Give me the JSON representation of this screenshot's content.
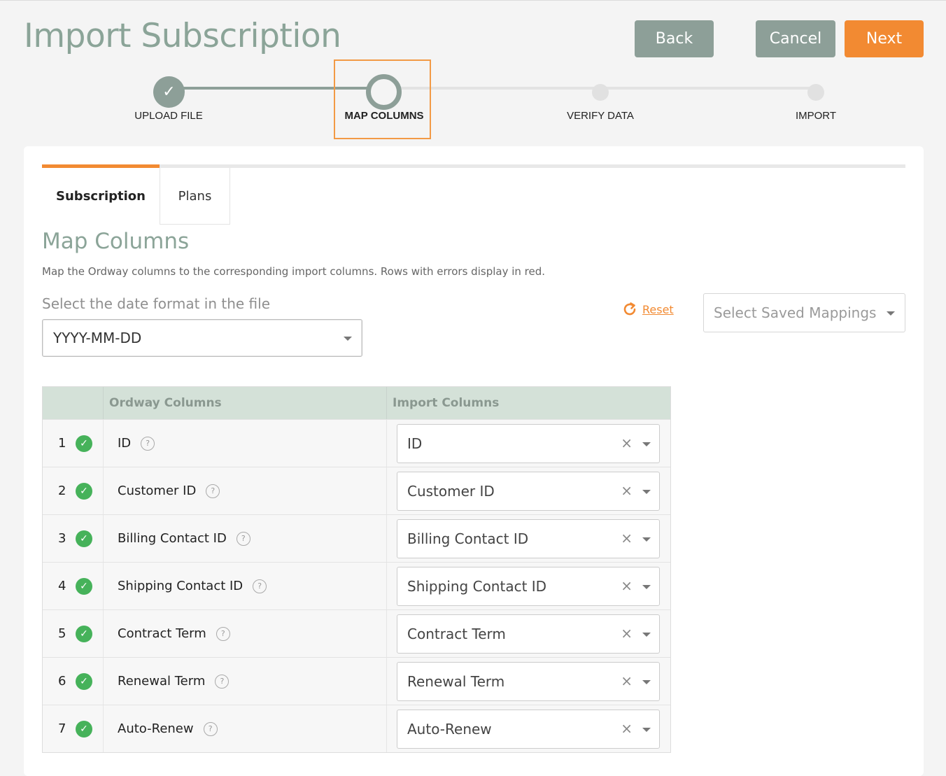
{
  "page": {
    "title": "Import Subscription",
    "buttons": {
      "back": "Back",
      "cancel": "Cancel",
      "next": "Next"
    }
  },
  "stepper": {
    "steps": [
      {
        "label": "UPLOAD FILE",
        "state": "done",
        "mark": "✓"
      },
      {
        "label": "MAP COLUMNS",
        "state": "current"
      },
      {
        "label": "VERIFY DATA",
        "state": "todo"
      },
      {
        "label": "IMPORT",
        "state": "todo"
      }
    ]
  },
  "tabs": [
    {
      "label": "Subscription",
      "active": true
    },
    {
      "label": "Plans",
      "active": false
    }
  ],
  "section": {
    "title": "Map Columns",
    "description": "Map the Ordway columns to the corresponding import columns. Rows with errors display in red.",
    "date_label": "Select the date format in the file",
    "date_value": "YYYY-MM-DD",
    "reset_label": "Reset",
    "saved_mappings_placeholder": "Select Saved Mappings"
  },
  "table": {
    "headers": [
      "",
      "Ordway Columns",
      "Import Columns"
    ],
    "rows": [
      {
        "num": "1",
        "ordway": "ID",
        "import": "ID"
      },
      {
        "num": "2",
        "ordway": "Customer ID",
        "import": "Customer ID"
      },
      {
        "num": "3",
        "ordway": "Billing Contact ID",
        "import": "Billing Contact ID"
      },
      {
        "num": "4",
        "ordway": "Shipping Contact ID",
        "import": "Shipping Contact ID"
      },
      {
        "num": "5",
        "ordway": "Contract Term",
        "import": "Contract Term"
      },
      {
        "num": "6",
        "ordway": "Renewal Term",
        "import": "Renewal Term"
      },
      {
        "num": "7",
        "ordway": "Auto-Renew",
        "import": "Auto-Renew"
      }
    ]
  },
  "icons": {
    "check": "✓",
    "help": "?",
    "clear": "×"
  },
  "colors": {
    "accent": "#f28a32",
    "muted": "#8d9f98",
    "success": "#46b25a",
    "header_bg": "#d4e1d8"
  }
}
